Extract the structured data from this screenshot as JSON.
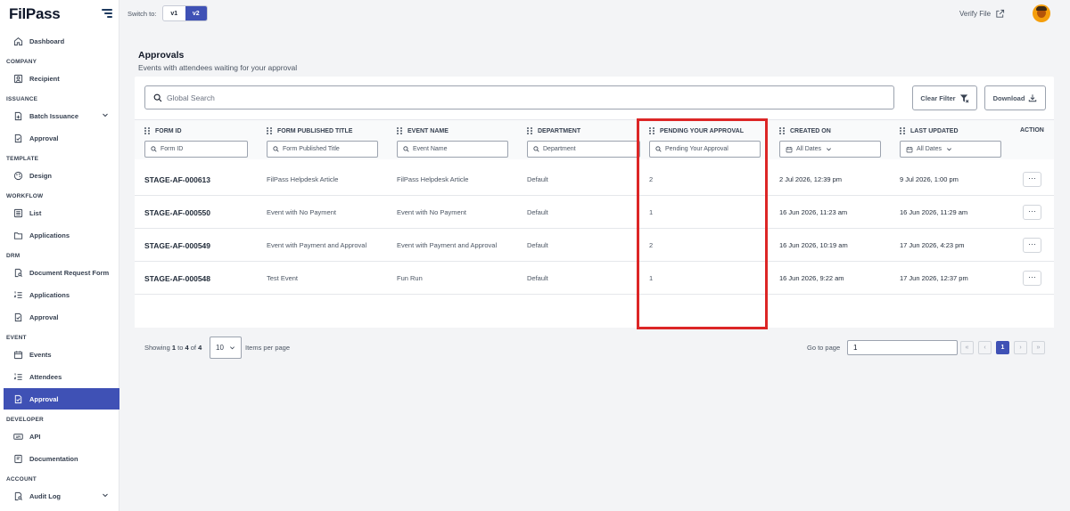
{
  "app": {
    "logo": "FilPass"
  },
  "topbar": {
    "switch_label": "Switch to:",
    "versions": [
      "v1",
      "v2"
    ],
    "active_version": "v2",
    "verify_file": "Verify File"
  },
  "sidebar": {
    "dashboard": "Dashboard",
    "sections": {
      "company": "COMPANY",
      "issuance": "ISSUANCE",
      "template": "TEMPLATE",
      "workflow": "WORKFLOW",
      "drm": "DRM",
      "event": "EVENT",
      "developer": "DEVELOPER",
      "account": "ACCOUNT"
    },
    "items": {
      "recipient": "Recipient",
      "batch_issuance": "Batch Issuance",
      "issuance_approval": "Approval",
      "design": "Design",
      "list": "List",
      "workflow_applications": "Applications",
      "document_request_form": "Document Request Form",
      "drm_applications": "Applications",
      "drm_approval": "Approval",
      "events": "Events",
      "attendees": "Attendees",
      "event_approval": "Approval",
      "api": "API",
      "documentation": "Documentation",
      "audit_log": "Audit Log"
    },
    "active_item": "event_approval"
  },
  "page": {
    "title": "Approvals",
    "subtitle": "Events with attendees waiting for your approval"
  },
  "toolbar": {
    "search_placeholder": "Global Search",
    "clear_filter": "Clear Filter",
    "download": "Download"
  },
  "table": {
    "columns": {
      "form_id": "FORM ID",
      "form_title": "FORM PUBLISHED TITLE",
      "event_name": "EVENT NAME",
      "department": "DEPARTMENT",
      "pending": "PENDING YOUR APPROVAL",
      "created": "CREATED ON",
      "updated": "LAST UPDATED",
      "action": "ACTION"
    },
    "filters": {
      "form_id": "Form ID",
      "form_title": "Form Published Title",
      "event_name": "Event Name",
      "department": "Department",
      "pending": "Pending Your Approval",
      "created": "All Dates",
      "updated": "All Dates"
    },
    "rows": [
      {
        "form_id": "STAGE-AF-000613",
        "form_title": "FilPass Helpdesk Article",
        "event_name": "FilPass Helpdesk Article",
        "department": "Default",
        "pending": "2",
        "created": "2 Jul 2026, 12:39 pm",
        "updated": "9 Jul 2026, 1:00 pm",
        "action": "···"
      },
      {
        "form_id": "STAGE-AF-000550",
        "form_title": "Event with No Payment",
        "event_name": "Event with No Payment",
        "department": "Default",
        "pending": "1",
        "created": "16 Jun 2026, 11:23 am",
        "updated": "16 Jun 2026, 11:29 am",
        "action": "···"
      },
      {
        "form_id": "STAGE-AF-000549",
        "form_title": "Event with Payment and Approval",
        "event_name": "Event with Payment and Approval",
        "department": "Default",
        "pending": "2",
        "created": "16 Jun 2026, 10:19 am",
        "updated": "17 Jun 2026, 4:23 pm",
        "action": "···"
      },
      {
        "form_id": "STAGE-AF-000548",
        "form_title": "Test Event",
        "event_name": "Fun Run",
        "department": "Default",
        "pending": "1",
        "created": "16 Jun 2026, 9:22 am",
        "updated": "17 Jun 2026, 12:37 pm",
        "action": "···"
      }
    ]
  },
  "pagination": {
    "showing_prefix": "Showing",
    "start": "1",
    "to": "to",
    "end": "4",
    "of": "of",
    "total": "4",
    "per_page": "10",
    "items_per_page": "Items per page",
    "go_to_page": "Go to page",
    "go_to_value": "1",
    "first": "«",
    "prev": "‹",
    "current": "1",
    "next": "›",
    "last": "»"
  },
  "colors": {
    "accent": "#3f51b5",
    "highlight": "#dc2626"
  }
}
